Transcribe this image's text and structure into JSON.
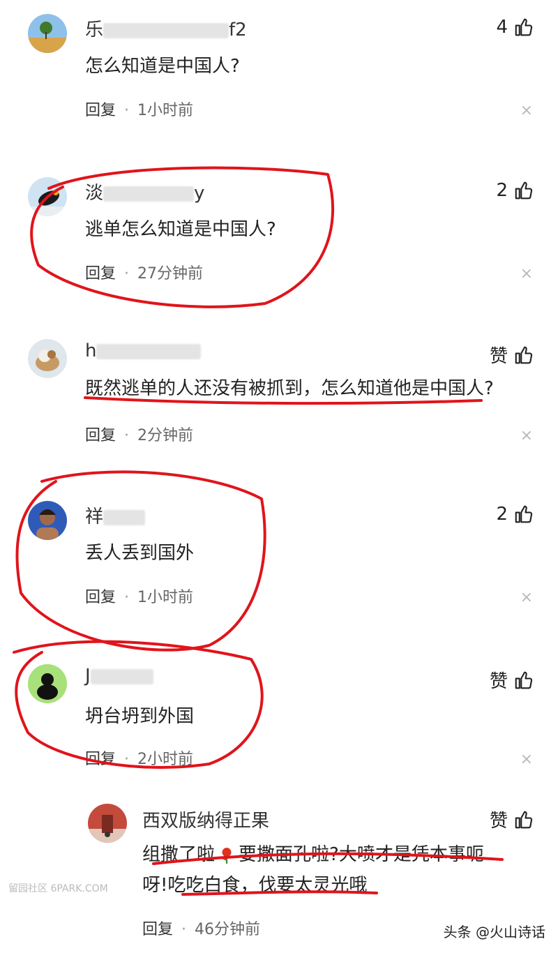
{
  "comments": [
    {
      "username_visible": "乐",
      "username_tail": "f2",
      "likes": "4",
      "text": "怎么知道是中国人?",
      "reply": "回复",
      "time": "1小时前"
    },
    {
      "username_visible": "淡",
      "username_tail": "y",
      "likes": "2",
      "text": "逃单怎么知道是中国人?",
      "reply": "回复",
      "time": "27分钟前"
    },
    {
      "username_visible": "h",
      "username_tail": "",
      "likes": "赞",
      "text": "既然逃单的人还没有被抓到，怎么知道他是中国人?",
      "reply": "回复",
      "time": "2分钟前"
    },
    {
      "username_visible": "祥",
      "username_tail": "",
      "likes": "2",
      "text": "丢人丢到国外",
      "reply": "回复",
      "time": "1小时前"
    },
    {
      "username_visible": "J",
      "username_tail": "",
      "likes": "赞",
      "text": "坍台坍到外国",
      "reply": "回复",
      "time": "2小时前"
    },
    {
      "username_visible": "西双版纳得正果",
      "username_tail": "",
      "likes": "赞",
      "text_line1": "组撒了啦",
      "text_line1b": "要撒面孔啦?大喷才是凭本事呃",
      "text_line2": "呀!吃吃白食，伐要太灵光哦",
      "reply": "回复",
      "time": "46分钟前"
    }
  ],
  "close_glyph": "×",
  "watermark_left": "留园社区 6PARK.COM",
  "watermark_right": "头条 @火山诗话",
  "icons": [
    "thumbs-up-icon",
    "close-icon",
    "rose-emoji-icon"
  ],
  "colors": {
    "annotation_red": "#e0141b",
    "meta_gray": "#666666"
  }
}
